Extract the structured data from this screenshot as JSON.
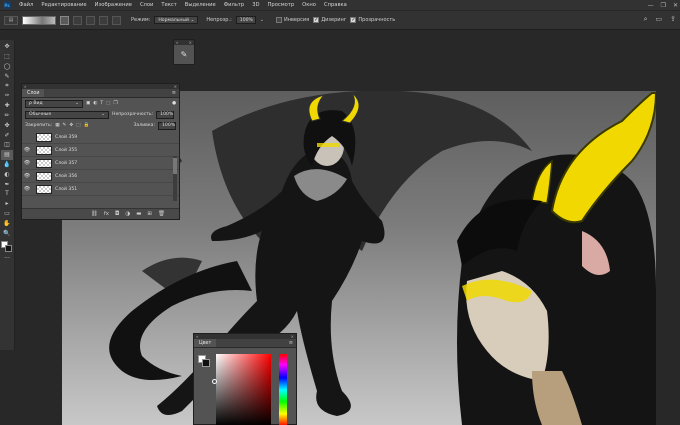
{
  "app": {
    "logo": "Ps"
  },
  "menu": [
    "Файл",
    "Редактирование",
    "Изображение",
    "Слои",
    "Текст",
    "Выделение",
    "Фильтр",
    "3D",
    "Просмотр",
    "Окно",
    "Справка"
  ],
  "window_controls": [
    "—",
    "❐",
    "✕"
  ],
  "options": {
    "mode_label": "Режим:",
    "mode_value": "Нормальный",
    "opacity_label": "Непрозр.:",
    "opacity_value": "100%",
    "invert_label": "Инверсия",
    "dither_label": "Дизеринг",
    "transparency_label": "Прозрачность",
    "invert_checked": false,
    "dither_checked": true,
    "transparency_checked": true
  },
  "toolbar": {
    "icons": [
      "move-icon",
      "marquee-icon",
      "lasso-icon",
      "quick-select-icon",
      "crop-icon",
      "eyedropper-icon",
      "healing-icon",
      "brush-icon",
      "stamp-icon",
      "history-brush-icon",
      "eraser-icon",
      "gradient-icon",
      "blur-icon",
      "dodge-icon",
      "pen-icon",
      "type-icon",
      "path-select-icon",
      "shape-icon",
      "hand-icon",
      "zoom-icon",
      "more-icon"
    ],
    "glyphs": [
      "✥",
      "⬚",
      "◯",
      "✎",
      "⌗",
      "✑",
      "✚",
      "✏",
      "✤",
      "✐",
      "◫",
      "▤",
      "💧",
      "◐",
      "✒",
      "T",
      "▸",
      "▭",
      "✋",
      "🔍",
      "···"
    ]
  },
  "layers_panel": {
    "tab": "Слои",
    "filter_label": "ρ Вид",
    "blend_mode": "Обычные",
    "opacity_label": "Непрозрачность:",
    "opacity_value": "100%",
    "lock_label": "Закрепить:",
    "fill_label": "Заливка:",
    "fill_value": "100%",
    "layers": [
      {
        "name": "Слой 359",
        "visible": false
      },
      {
        "name": "Слой 355",
        "visible": true
      },
      {
        "name": "Слой 357",
        "visible": true
      },
      {
        "name": "Слой 356",
        "visible": true
      },
      {
        "name": "Слой 351",
        "visible": true
      }
    ],
    "footer_icons": [
      "link-icon",
      "fx-icon",
      "mask-icon",
      "adjustment-icon",
      "folder-icon",
      "new-layer-icon",
      "trash-icon"
    ],
    "footer_glyphs": [
      "⛓",
      "fx",
      "◘",
      "◑",
      "▬",
      "⊞",
      "🗑"
    ]
  },
  "color_panel": {
    "tab": "Цвет"
  },
  "colors": {
    "accent_yellow": "#f0d800",
    "canvas_bg": "#282828",
    "panel_bg": "#535353"
  }
}
